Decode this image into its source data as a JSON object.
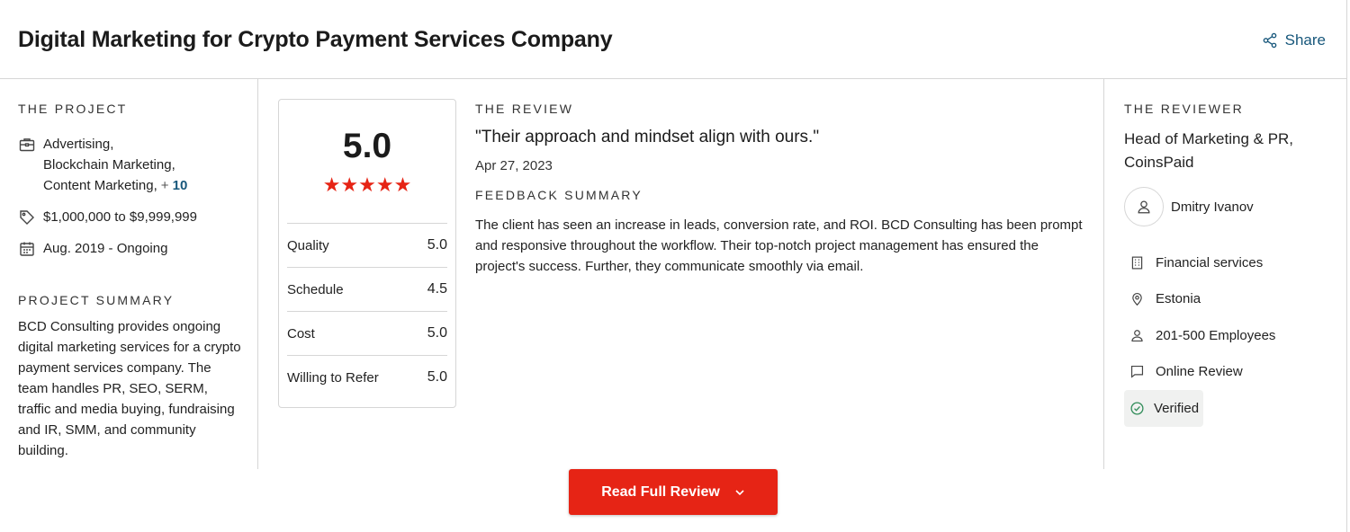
{
  "header": {
    "title": "Digital Marketing for Crypto Payment Services Company",
    "share_label": "Share"
  },
  "project": {
    "section_label": "THE PROJECT",
    "services_lines": [
      "Advertising,",
      "Blockchain Marketing,",
      "Content Marketing,"
    ],
    "services_more_prefix": "+",
    "services_more_count": "10",
    "budget": "$1,000,000 to $9,999,999",
    "timeline": "Aug. 2019 - Ongoing",
    "summary_label": "PROJECT SUMMARY",
    "summary_text": "BCD Consulting provides ongoing digital marketing services for a crypto payment services company. The team handles PR, SEO, SERM, traffic and media buying, fundraising and IR, SMM, and community building."
  },
  "rating": {
    "overall": "5.0",
    "stars": "★★★★★",
    "rows": [
      {
        "label": "Quality",
        "value": "5.0"
      },
      {
        "label": "Schedule",
        "value": "4.5"
      },
      {
        "label": "Cost",
        "value": "5.0"
      },
      {
        "label": "Willing to Refer",
        "value": "5.0"
      }
    ]
  },
  "review": {
    "section_label": "THE REVIEW",
    "quote": "\"Their approach and mindset align with ours.\"",
    "date": "Apr 27, 2023",
    "feedback_label": "FEEDBACK SUMMARY",
    "feedback_text": "The client has seen an increase in leads, conversion rate, and ROI. BCD Consulting has been prompt and responsive throughout the workflow. Their top-notch project management has ensured the project's success. Further, they communicate smoothly via email."
  },
  "reviewer": {
    "section_label": "THE REVIEWER",
    "role": "Head of Marketing & PR, CoinsPaid",
    "name": "Dmitry Ivanov",
    "industry": "Financial services",
    "location": "Estonia",
    "size": "201-500 Employees",
    "review_type": "Online Review",
    "verified": "Verified"
  },
  "actions": {
    "read_full_review": "Read Full Review"
  },
  "colors": {
    "accent_red": "#e62415",
    "link_blue": "#17577b",
    "verified_green": "#2e8b57"
  }
}
